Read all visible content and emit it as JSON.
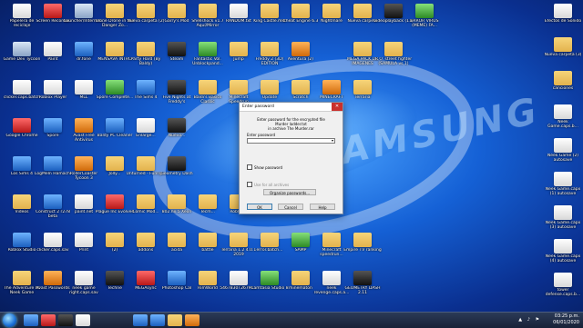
{
  "desktop": {
    "brand_text": "SAMSUNG",
    "icons": [
      {
        "label": "Papelera de reciclaje",
        "col": 0,
        "row": 0,
        "style": "white"
      },
      {
        "label": "Screen Recorder",
        "col": 1,
        "row": 0,
        "style": "red"
      },
      {
        "label": "Launcher/Internet...",
        "col": 2,
        "row": 0,
        "style": "app"
      },
      {
        "label": "Clone Drone in the Danger Zo...",
        "col": 3,
        "row": 0,
        "style": "folder"
      },
      {
        "label": "Nueva carpeta (2)",
        "col": 4,
        "row": 0,
        "style": "folder"
      },
      {
        "label": "Garry's Mod",
        "col": 5,
        "row": 0,
        "style": "folder"
      },
      {
        "label": "Shellshock v1.7 Aquí/Mirror",
        "col": 6,
        "row": 0,
        "style": "folder"
      },
      {
        "label": "RANDOM.txt",
        "col": 7,
        "row": 0,
        "style": "white"
      },
      {
        "label": "King Castle.mkt",
        "col": 8,
        "row": 0,
        "style": "folder"
      },
      {
        "label": "Cheat Engine 6.3",
        "col": 9,
        "row": 0,
        "style": "folder"
      },
      {
        "label": "Nightmare",
        "col": 10,
        "row": 0,
        "style": "folder"
      },
      {
        "label": "Nueva carpeta",
        "col": 11,
        "row": 0,
        "style": "folder"
      },
      {
        "label": "videoplayback (11)",
        "col": 12,
        "row": 0,
        "style": "dark"
      },
      {
        "label": "ERROR VIRUS (MEME) FA...",
        "col": 13,
        "row": 0,
        "style": "green"
      },
      {
        "label": "Game Dev Tycoon",
        "col": 0,
        "row": 1,
        "style": "app"
      },
      {
        "label": "Paint",
        "col": 1,
        "row": 1,
        "style": "white"
      },
      {
        "label": "dr.fone",
        "col": 2,
        "row": 1,
        "style": "blue"
      },
      {
        "label": "MENSAVA INTRO",
        "col": 3,
        "row": 1,
        "style": "folder"
      },
      {
        "label": "Party Hard (By Baldy)",
        "col": 4,
        "row": 1,
        "style": "folder"
      },
      {
        "label": "Steam",
        "col": 5,
        "row": 1,
        "style": "dark"
      },
      {
        "label": "Fantastic Vol. Unblockpand...",
        "col": 6,
        "row": 1,
        "style": "green"
      },
      {
        "label": "Jump",
        "col": 7,
        "row": 1,
        "style": "folder"
      },
      {
        "label": "Freddy 2 (3D) EDITION",
        "col": 8,
        "row": 1,
        "style": "folder"
      },
      {
        "label": "Aventura (2)",
        "col": 9,
        "row": 1,
        "style": "orange"
      },
      {
        "label": "MEGA PACK DE IMAGENES",
        "col": 11,
        "row": 1,
        "style": "folder"
      },
      {
        "label": "R.O. street fighter (SAMULA vs 1)",
        "col": 12,
        "row": 1,
        "style": "folder"
      },
      {
        "label": "clicker.caps.batch",
        "col": 0,
        "row": 2,
        "style": "white"
      },
      {
        "label": "Roblox Player",
        "col": 1,
        "row": 2,
        "style": "white"
      },
      {
        "label": "MLL",
        "col": 2,
        "row": 2,
        "style": "white"
      },
      {
        "label": "Spore Complete...",
        "col": 3,
        "row": 2,
        "style": "green"
      },
      {
        "label": "The Sims 4",
        "col": 4,
        "row": 2,
        "style": "blue"
      },
      {
        "label": "Five Nights at Freddy's",
        "col": 5,
        "row": 2,
        "style": "dark"
      },
      {
        "label": "Baldi's Basics Classic",
        "col": 6,
        "row": 2,
        "style": "folder"
      },
      {
        "label": "Minecraft Speedrun",
        "col": 7,
        "row": 2,
        "style": "folder"
      },
      {
        "label": "Update",
        "col": 8,
        "row": 2,
        "style": "folder"
      },
      {
        "label": "Scratch",
        "col": 9,
        "row": 2,
        "style": "folder"
      },
      {
        "label": "MINECRAFT",
        "col": 10,
        "row": 2,
        "style": "orange"
      },
      {
        "label": "Terraria",
        "col": 11,
        "row": 2,
        "style": "folder"
      },
      {
        "label": "Google Chrome",
        "col": 0,
        "row": 3,
        "style": "red"
      },
      {
        "label": "Spore",
        "col": 1,
        "row": 3,
        "style": "blue"
      },
      {
        "label": "Avast Free Antivirus",
        "col": 2,
        "row": 3,
        "style": "orange"
      },
      {
        "label": "Baldy PC Cleaner",
        "col": 3,
        "row": 3,
        "style": "blue"
      },
      {
        "label": "Enlarge...",
        "col": 4,
        "row": 3,
        "style": "white"
      },
      {
        "label": "Nuevo...",
        "col": 5,
        "row": 3,
        "style": "dark"
      },
      {
        "label": "Los Sims 4",
        "col": 0,
        "row": 4,
        "style": "blue"
      },
      {
        "label": "LogMeIn Hamachi",
        "col": 1,
        "row": 4,
        "style": "blue"
      },
      {
        "label": "RollerCoaster Tycoon 3",
        "col": 2,
        "row": 4,
        "style": "orange"
      },
      {
        "label": "Jolly...",
        "col": 3,
        "row": 4,
        "style": "folder"
      },
      {
        "label": "Unturned - Funny...",
        "col": 4,
        "row": 4,
        "style": "folder"
      },
      {
        "label": "Geometry Dash",
        "col": 5,
        "row": 4,
        "style": "dark"
      },
      {
        "label": "Videos",
        "col": 0,
        "row": 5,
        "style": "folder"
      },
      {
        "label": "Construct 2 r278 beta",
        "col": 1,
        "row": 5,
        "style": "blue"
      },
      {
        "label": "paint.net",
        "col": 2,
        "row": 5,
        "style": "white"
      },
      {
        "label": "Plague Inc Evolved",
        "col": 3,
        "row": 5,
        "style": "red"
      },
      {
        "label": "Comic Mod...",
        "col": 4,
        "row": 5,
        "style": "folder"
      },
      {
        "label": "802.nx.5 Xeon",
        "col": 5,
        "row": 5,
        "style": "folder"
      },
      {
        "label": "Tecm...",
        "col": 6,
        "row": 5,
        "style": "folder"
      },
      {
        "label": "Roblox...",
        "col": 7,
        "row": 5,
        "style": "folder"
      },
      {
        "label": "Roblox Studio",
        "col": 0,
        "row": 6,
        "style": "blue"
      },
      {
        "label": "clicker.caps.sav",
        "col": 1,
        "row": 6,
        "style": "white"
      },
      {
        "label": "Print",
        "col": 2,
        "row": 6,
        "style": "white"
      },
      {
        "label": "(2)",
        "col": 3,
        "row": 6,
        "style": "folder"
      },
      {
        "label": "addons",
        "col": 4,
        "row": 6,
        "style": "folder"
      },
      {
        "label": "acida",
        "col": 5,
        "row": 6,
        "style": "folder"
      },
      {
        "label": "battle",
        "col": 6,
        "row": 6,
        "style": "folder"
      },
      {
        "label": "Terraria 1.2 4.0.1 2019",
        "col": 7,
        "row": 6,
        "style": "folder"
      },
      {
        "label": "error.batch...",
        "col": 8,
        "row": 6,
        "style": "folder"
      },
      {
        "label": "SAMP",
        "col": 9,
        "row": 6,
        "style": "green"
      },
      {
        "label": "Minecraft speedrun...",
        "col": 10,
        "row": 6,
        "style": "folder"
      },
      {
        "label": "Empire TV ranking",
        "col": 11,
        "row": 6,
        "style": "folder"
      },
      {
        "label": "The Adventure Of Neek Game",
        "col": 0,
        "row": 7,
        "style": "folder"
      },
      {
        "label": "Avast Passwords",
        "col": 1,
        "row": 7,
        "style": "orange"
      },
      {
        "label": "neek game right.caps.sav",
        "col": 2,
        "row": 7,
        "style": "white"
      },
      {
        "label": "Techne",
        "col": 3,
        "row": 7,
        "style": "dark"
      },
      {
        "label": "MEGAsync",
        "col": 4,
        "row": 7,
        "style": "red"
      },
      {
        "label": "Photoshop Cal",
        "col": 5,
        "row": 7,
        "style": "blue"
      },
      {
        "label": "RimWorld",
        "col": 6,
        "row": 7,
        "style": "folder"
      },
      {
        "label": "5467830T26791...",
        "col": 7,
        "row": 7,
        "style": "white"
      },
      {
        "label": "Camtasia Studio 8",
        "col": 8,
        "row": 7,
        "style": "green"
      },
      {
        "label": "minematon",
        "col": 9,
        "row": 7,
        "style": "folder"
      },
      {
        "label": "neek revenge.caps.a...",
        "col": 10,
        "row": 7,
        "style": "white"
      },
      {
        "label": "GEOMETRY DASH 2.11",
        "col": 11,
        "row": 7,
        "style": "dark"
      }
    ],
    "right_icons": [
      {
        "label": "Efectos de Sonido",
        "row": 0,
        "style": "white"
      },
      {
        "label": "Nueva carpeta (3)",
        "row": 1,
        "style": "folder"
      },
      {
        "label": "canciones",
        "row": 2,
        "style": "folder"
      },
      {
        "label": "Neek Game.caps.b...",
        "row": 3,
        "style": "white"
      },
      {
        "label": "Neek Game (2) autosave",
        "row": 4,
        "style": "white"
      },
      {
        "label": "Neek Game.capx (1) autosave",
        "row": 5,
        "style": "white"
      },
      {
        "label": "Neek Game.capx (3) autosave",
        "row": 6,
        "style": "white"
      },
      {
        "label": "Neek Game.capx (4) autosave",
        "row": 7,
        "style": "white"
      },
      {
        "label": "tower defense.caps.b...",
        "row": 8,
        "style": "white"
      }
    ]
  },
  "dialog": {
    "title": "Enter password",
    "message_line1": "Enter password for the encrypted file",
    "message_line2": "Murder ladder.txt",
    "message_line3": "in archive The Murder.rar",
    "password_label": "Enter password",
    "show_password_label": "Show password",
    "use_for_all_label": "Use for all archives",
    "organize_label": "Organize passwords...",
    "ok_label": "OK",
    "cancel_label": "Cancel",
    "help_label": "Help"
  },
  "taskbar": {
    "time": "03:25 p.m.",
    "date": "06/01/2020",
    "apps": [
      "explorer",
      "browser",
      "media",
      "settings",
      "photoshop",
      "ie",
      "folder",
      "winrar"
    ]
  }
}
